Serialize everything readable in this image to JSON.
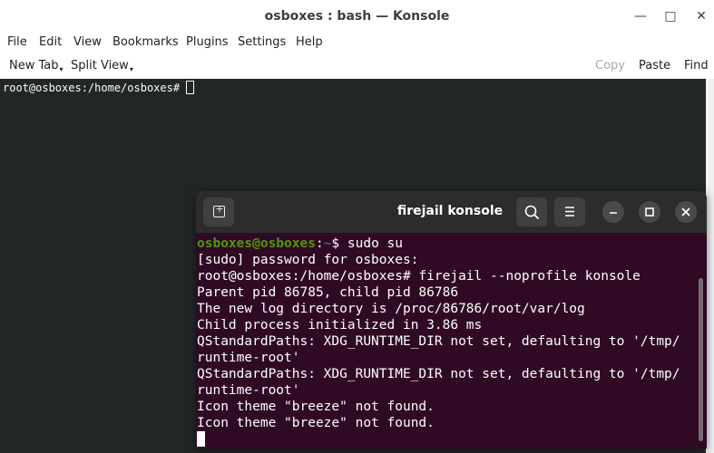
{
  "konsole": {
    "title": "osboxes : bash — Konsole",
    "window_buttons": {
      "minimize": "—",
      "maximize": "□",
      "close": "✕"
    },
    "menu": [
      "File",
      "Edit",
      "View",
      "Bookmarks",
      "Plugins",
      "Settings",
      "Help"
    ],
    "toolbar": {
      "new_tab": "New Tab",
      "split_view": "Split View",
      "copy": "Copy",
      "paste": "Paste",
      "find": "Find"
    },
    "terminal": {
      "prompt": "root@osboxes:/home/osboxes# "
    }
  },
  "firejail": {
    "title": "firejail konsole",
    "icons": {
      "new_tab": "new-tab-icon",
      "search": "search-icon",
      "menu": "hamburger-icon",
      "minimize": "minimize-icon",
      "maximize": "maximize-icon",
      "close": "close-icon"
    },
    "prompt_user": "osboxes@osboxes",
    "prompt_path": "~",
    "prompt_cmd": "$ sudo su",
    "lines": [
      "[sudo] password for osboxes:",
      "root@osboxes:/home/osboxes# firejail --noprofile konsole",
      "Parent pid 86785, child pid 86786",
      "The new log directory is /proc/86786/root/var/log",
      "Child process initialized in 3.86 ms",
      "QStandardPaths: XDG_RUNTIME_DIR not set, defaulting to '/tmp/",
      "runtime-root'",
      "QStandardPaths: XDG_RUNTIME_DIR not set, defaulting to '/tmp/",
      "runtime-root'",
      "Icon theme \"breeze\" not found.",
      "Icon theme \"breeze\" not found."
    ]
  },
  "colors": {
    "konsole_bg": "#232627",
    "firejail_bg": "#300a24",
    "prompt_user": "#4e9a06",
    "prompt_path": "#3465a4"
  }
}
